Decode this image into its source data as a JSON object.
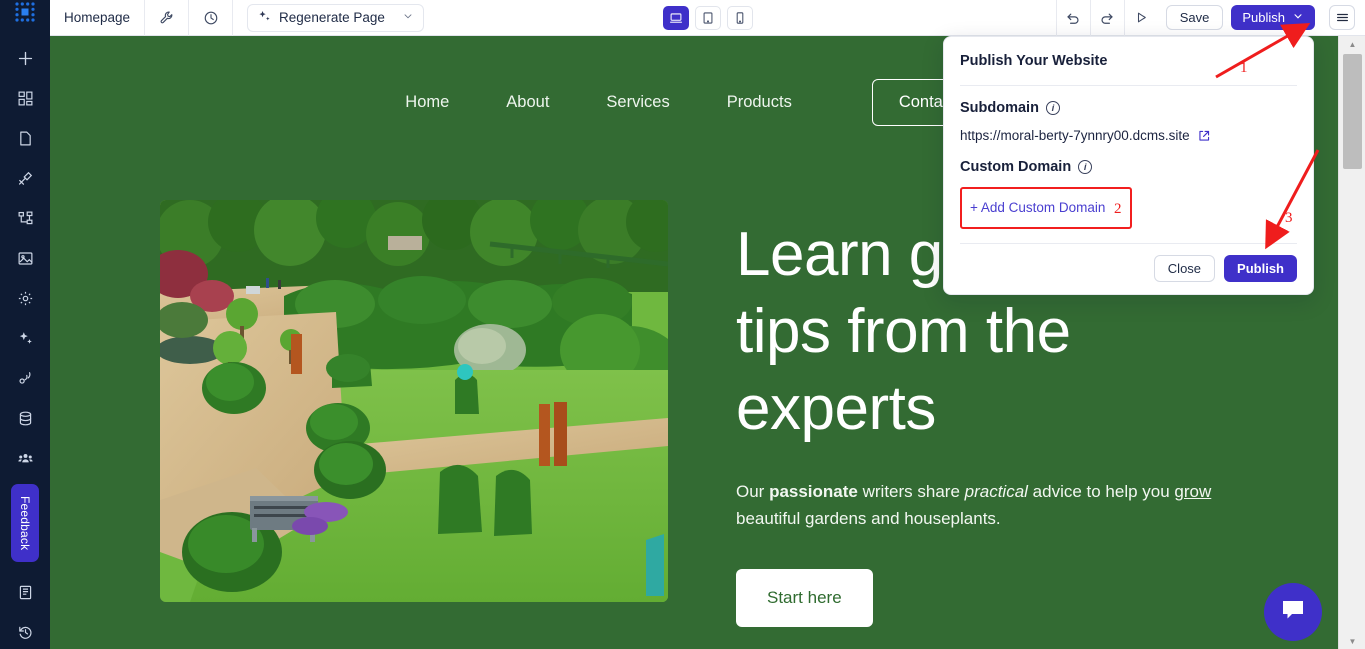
{
  "app": {
    "logo_icon": "dot-grid-logo-icon",
    "accent_purple": "#3f30c9",
    "site_green": "#336b33",
    "annotation_red": "#ef1d1d"
  },
  "toolbar": {
    "page_name": "Homepage",
    "tools_icon": "wrench-icon",
    "history_icon": "clock-icon",
    "regenerate_label": "Regenerate Page",
    "regenerate_icon": "sparkles-icon",
    "regenerate_chevron": "chevron-down-icon",
    "undo_icon": "undo-icon",
    "redo_icon": "redo-icon",
    "preview_icon": "play-icon",
    "save_label": "Save",
    "publish_label": "Publish",
    "publish_chevron": "chevron-down-icon",
    "menu_icon": "hamburger-menu-icon",
    "devices": [
      {
        "name": "desktop",
        "icon": "desktop-icon",
        "active": true
      },
      {
        "name": "tablet",
        "icon": "tablet-icon",
        "active": false
      },
      {
        "name": "mobile",
        "icon": "mobile-icon",
        "active": false
      }
    ]
  },
  "sidebar": {
    "items": [
      {
        "icon": "plus-icon",
        "name": "add"
      },
      {
        "icon": "grid-blocks-icon",
        "name": "sections"
      },
      {
        "icon": "page-icon",
        "name": "pages"
      },
      {
        "icon": "brush-palette-icon",
        "name": "design"
      },
      {
        "icon": "sitemap-icon",
        "name": "structure"
      },
      {
        "icon": "image-icon",
        "name": "media"
      },
      {
        "icon": "gear-icon",
        "name": "settings"
      },
      {
        "icon": "sparkles-icon",
        "name": "ai-tools"
      },
      {
        "icon": "broadcast-icon",
        "name": "marketing"
      },
      {
        "icon": "database-icon",
        "name": "collections"
      },
      {
        "icon": "people-icon",
        "name": "members"
      }
    ],
    "feedback_label": "Feedback",
    "bottom_items": [
      {
        "icon": "book-icon",
        "name": "docs"
      },
      {
        "icon": "history-restore-icon",
        "name": "restore"
      }
    ]
  },
  "site": {
    "nav": [
      {
        "label": "Home"
      },
      {
        "label": "About"
      },
      {
        "label": "Services"
      },
      {
        "label": "Products"
      },
      {
        "label": "Contact",
        "is_button": true
      }
    ],
    "hero": {
      "image_alt": "topiary-garden-photo",
      "title": "Learn g",
      "title_line2": "tips from the",
      "title_line3": "experts",
      "sub_prefix": "Our ",
      "sub_bold": "passionate",
      "sub_mid1": " writers share ",
      "sub_italic": "practical",
      "sub_mid2": " advice to help you ",
      "sub_underline": "grow",
      "sub_tail": " beautiful gardens and houseplants.",
      "cta_label": "Start here"
    },
    "chat_icon": "chat-bubble-icon"
  },
  "publish_panel": {
    "title": "Publish Your Website",
    "subdomain_label": "Subdomain",
    "subdomain_info_icon": "info-icon",
    "subdomain_url": "https://moral-berty-7ynnry00.dcms.site",
    "external_link_icon": "external-link-icon",
    "custom_domain_label": "Custom Domain",
    "custom_domain_info_icon": "info-icon",
    "add_custom_domain_label": "+ Add Custom Domain",
    "close_label": "Close",
    "publish_label": "Publish"
  },
  "annotations": {
    "markers": [
      {
        "number": "1",
        "points_to": "publish-button-top"
      },
      {
        "number": "2",
        "points_to": "add-custom-domain-box"
      },
      {
        "number": "3",
        "points_to": "publish-button-panel"
      }
    ]
  },
  "scrollbar": {
    "up_icon": "triangle-up-icon",
    "down_icon": "triangle-down-icon"
  }
}
